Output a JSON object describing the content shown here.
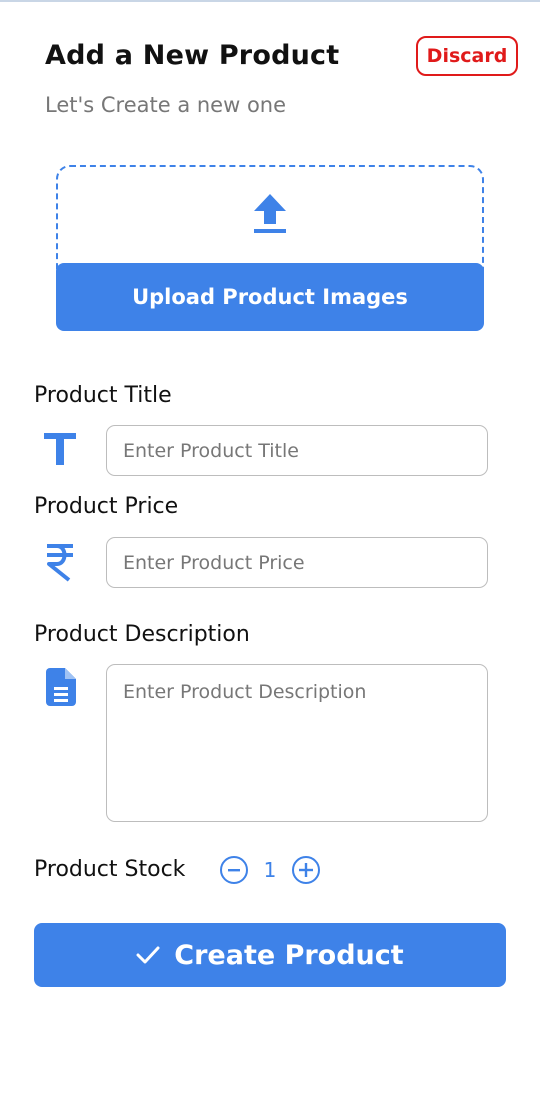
{
  "header": {
    "title": "Add a New Product",
    "subtitle": "Let's Create a new one",
    "discard_label": "Discard"
  },
  "upload": {
    "button_label": "Upload Product Images",
    "icon": "upload-icon"
  },
  "fields": {
    "title": {
      "label": "Product Title",
      "placeholder": "Enter Product Title",
      "value": "",
      "icon": "text-title-icon"
    },
    "price": {
      "label": "Product Price",
      "placeholder": "Enter Product Price",
      "value": "",
      "icon": "rupee-icon"
    },
    "description": {
      "label": "Product Description",
      "placeholder": "Enter Product Description",
      "value": "",
      "icon": "document-icon"
    }
  },
  "stock": {
    "label": "Product Stock",
    "value": "1"
  },
  "submit": {
    "label": "Create Product",
    "icon": "checkmark-icon"
  },
  "colors": {
    "accent": "#3e82e8",
    "danger": "#e01a1a",
    "muted_text": "#777777"
  }
}
